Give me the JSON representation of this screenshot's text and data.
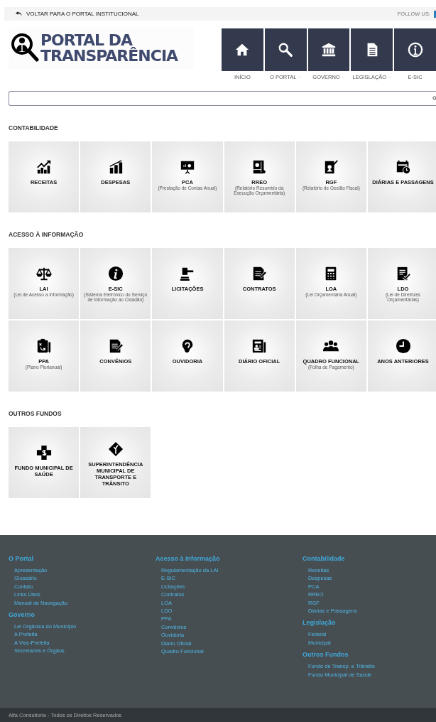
{
  "top_bar": {
    "back_link": "VOLTAR PARA O PORTAL INSTITUCIONAL",
    "follow_label": "FOLLOW US:"
  },
  "logo": {
    "line_1": "PORTAL DA",
    "line_2": "TRANSPARÊNCIA"
  },
  "nav": [
    {
      "label": "INÍCIO",
      "dropdown": false
    },
    {
      "label": "O PORTAL",
      "dropdown": true
    },
    {
      "label": "GOVERNO",
      "dropdown": true
    },
    {
      "label": "LEGISLAÇÃO",
      "dropdown": true
    },
    {
      "label": "E-SIC",
      "dropdown": false
    }
  ],
  "sections": [
    {
      "title": "CONTABILIDADE",
      "tiles": [
        {
          "label": "RECEITAS"
        },
        {
          "label": "DESPESAS"
        },
        {
          "label": "PCA",
          "subtitle": "(Prestação de Contas Anual)"
        },
        {
          "label": "RREO",
          "subtitle": "(Relatório Resumido da Execução Orçamentária)"
        },
        {
          "label": "RGF",
          "subtitle": "(Relatório de Gestão Fiscal)"
        },
        {
          "label": "DIÁRIAS E PASSAGENS"
        }
      ]
    },
    {
      "title": "ACESSO À INFORMAÇÃO",
      "tiles": [
        {
          "label": "LAI",
          "subtitle": "(Lei de Acesso a Informação)"
        },
        {
          "label": "E-SIC",
          "subtitle": "(Sistema Eletrônico do Serviço de Informação ao Cidadão)"
        },
        {
          "label": "LICITAÇÕES"
        },
        {
          "label": "CONTRATOS"
        },
        {
          "label": "LOA",
          "subtitle": "(Lei Orçamentária Anual)"
        },
        {
          "label": "LDO",
          "subtitle": "(Lei de Diretrizes Orçamentárias)"
        },
        {
          "label": "PPA",
          "subtitle": "(Plano Plurianual)"
        },
        {
          "label": "CONVÊNIOS"
        },
        {
          "label": "OUVIDORIA"
        },
        {
          "label": "DIÁRIO OFICIAL"
        },
        {
          "label": "QUADRO FUNCIONAL",
          "subtitle": "(Folha de Pagamento)"
        },
        {
          "label": "ANOS ANTERIORES"
        }
      ]
    },
    {
      "title": "OUTROS FUNDOS",
      "tiles": [
        {
          "label": "FUNDO MUNICIPAL DE SAÚDE"
        },
        {
          "label": "SUPERINTENDÊNCIA MUNICIPAL DE TRANSPORTE E TRÂNSITO"
        }
      ]
    }
  ],
  "footer": {
    "columns": [
      {
        "groups": [
          {
            "title": "O Portal",
            "links": [
              "Apresentação",
              "Glossário",
              "Contato",
              "Links Úteis",
              "Manual de Navegação"
            ]
          },
          {
            "title": "Governo",
            "links": [
              "Lei Orgânica do Município",
              "A Prefeita",
              "A Vice-Prefeita",
              "Secretarias e Órgãos"
            ]
          }
        ]
      },
      {
        "groups": [
          {
            "title": "Acesso à Informação",
            "links": [
              "Regulamentação da LAI",
              "E-SIC",
              "Licitações",
              "Contratos",
              "LOA",
              "LDO",
              "PPA",
              "Convênios",
              "Ouvidoria",
              "Diário Oficial",
              "Quadro Funcional"
            ]
          }
        ]
      },
      {
        "groups": [
          {
            "title": "Contabilidade",
            "links": [
              "Receitas",
              "Despesas",
              "PCA",
              "RREO",
              "RGF",
              "Diárias e Passagens"
            ]
          },
          {
            "title": "Legislação",
            "links": [
              "Federal",
              "Municipal"
            ]
          },
          {
            "title": "Outros Fundos",
            "links": [
              "Fundo de Transp. e Trânsito",
              "Fundo Municipal de Saúde"
            ]
          }
        ]
      }
    ],
    "copyright": "Alfa Consultoria - Todos os Direitos Reservados"
  }
}
